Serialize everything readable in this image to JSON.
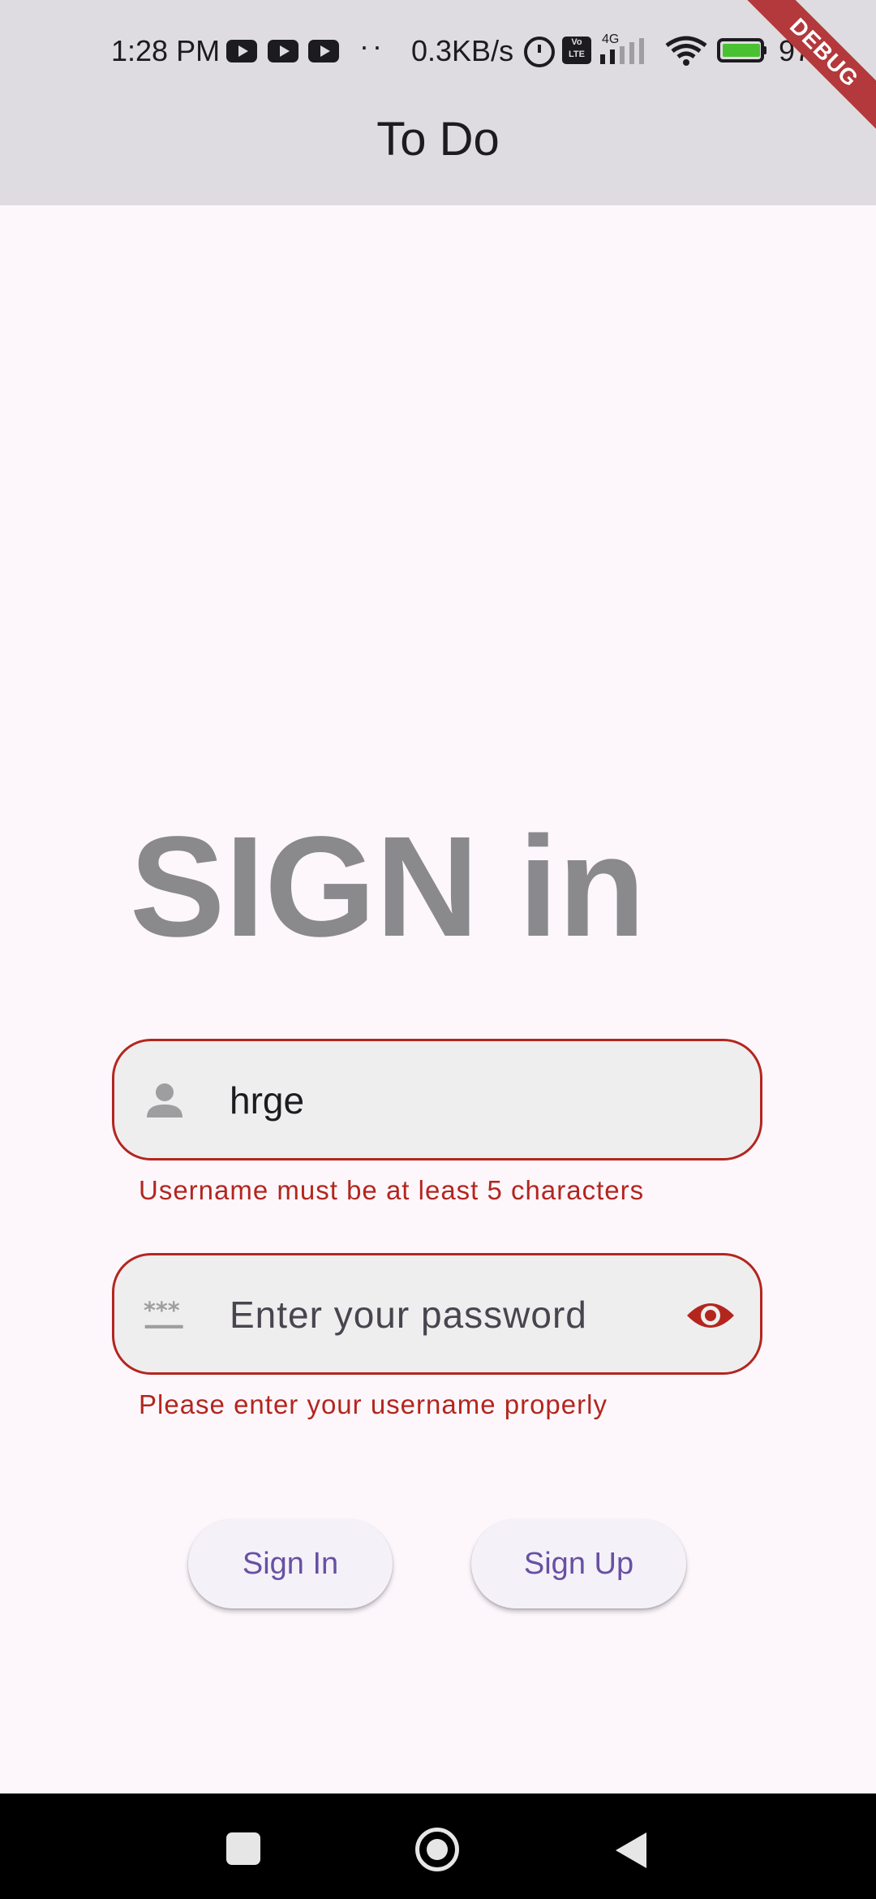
{
  "status_bar": {
    "time": "1:28 PM",
    "overflow_dots": "··",
    "network_speed": "0.3KB/s",
    "volte_label": "Vo LTE",
    "network_type": "4G",
    "battery_percent": "97%",
    "notification_icons": [
      "youtube-icon",
      "youtube-icon",
      "youtube-icon"
    ]
  },
  "app_bar": {
    "title": "To Do",
    "debug_banner": "DEBUG"
  },
  "main": {
    "heading": "SIGN in",
    "username": {
      "value": "hrge",
      "icon": "person-icon",
      "error": "Username must be at least 5 characters"
    },
    "password": {
      "placeholder": "Enter your password",
      "icon": "password-icon",
      "trailing_icon": "eye-icon",
      "error": "Please enter your username properly"
    },
    "buttons": {
      "sign_in": "Sign In",
      "sign_up": "Sign Up"
    }
  },
  "colors": {
    "error": "#b3261e",
    "accent": "#6750a4",
    "heading": "#8a898c",
    "app_bar": "#dedce0",
    "background": "#fdf7fc"
  },
  "nav_bar": {
    "items": [
      "recent-apps-icon",
      "home-icon",
      "back-icon"
    ]
  }
}
